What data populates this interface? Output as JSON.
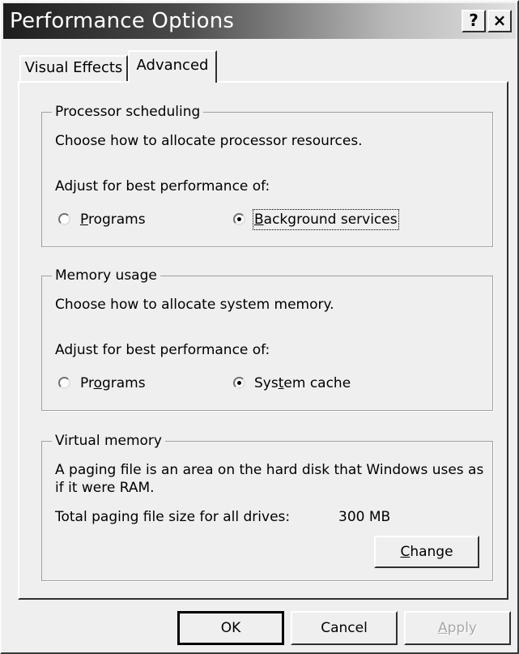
{
  "window": {
    "title": "Performance Options"
  },
  "titlebar": {
    "help_label": "?",
    "close_label": "×"
  },
  "tabs": [
    {
      "label": "Visual Effects",
      "active": false
    },
    {
      "label": "Advanced",
      "active": true
    }
  ],
  "processor": {
    "title": "Processor scheduling",
    "description": "Choose how to allocate processor resources.",
    "adjust_label": "Adjust for best performance of:",
    "options": [
      {
        "label": "Programs",
        "selected": false
      },
      {
        "label": "Background services",
        "selected": true
      }
    ]
  },
  "memory": {
    "title": "Memory usage",
    "description": "Choose how to allocate system memory.",
    "adjust_label": "Adjust for best performance of:",
    "options": [
      {
        "label": "Programs",
        "selected": false
      },
      {
        "label": "System cache",
        "selected": true
      }
    ]
  },
  "virtual_memory": {
    "title": "Virtual memory",
    "description_line1": "A paging file is an area on the hard disk that Windows uses as",
    "description_line2": "if it were RAM.",
    "total_label": "Total paging file size for all drives:",
    "total_value": "300 MB",
    "change_button": "Change"
  },
  "buttons": {
    "ok": "OK",
    "cancel": "Cancel",
    "apply": "Apply"
  }
}
